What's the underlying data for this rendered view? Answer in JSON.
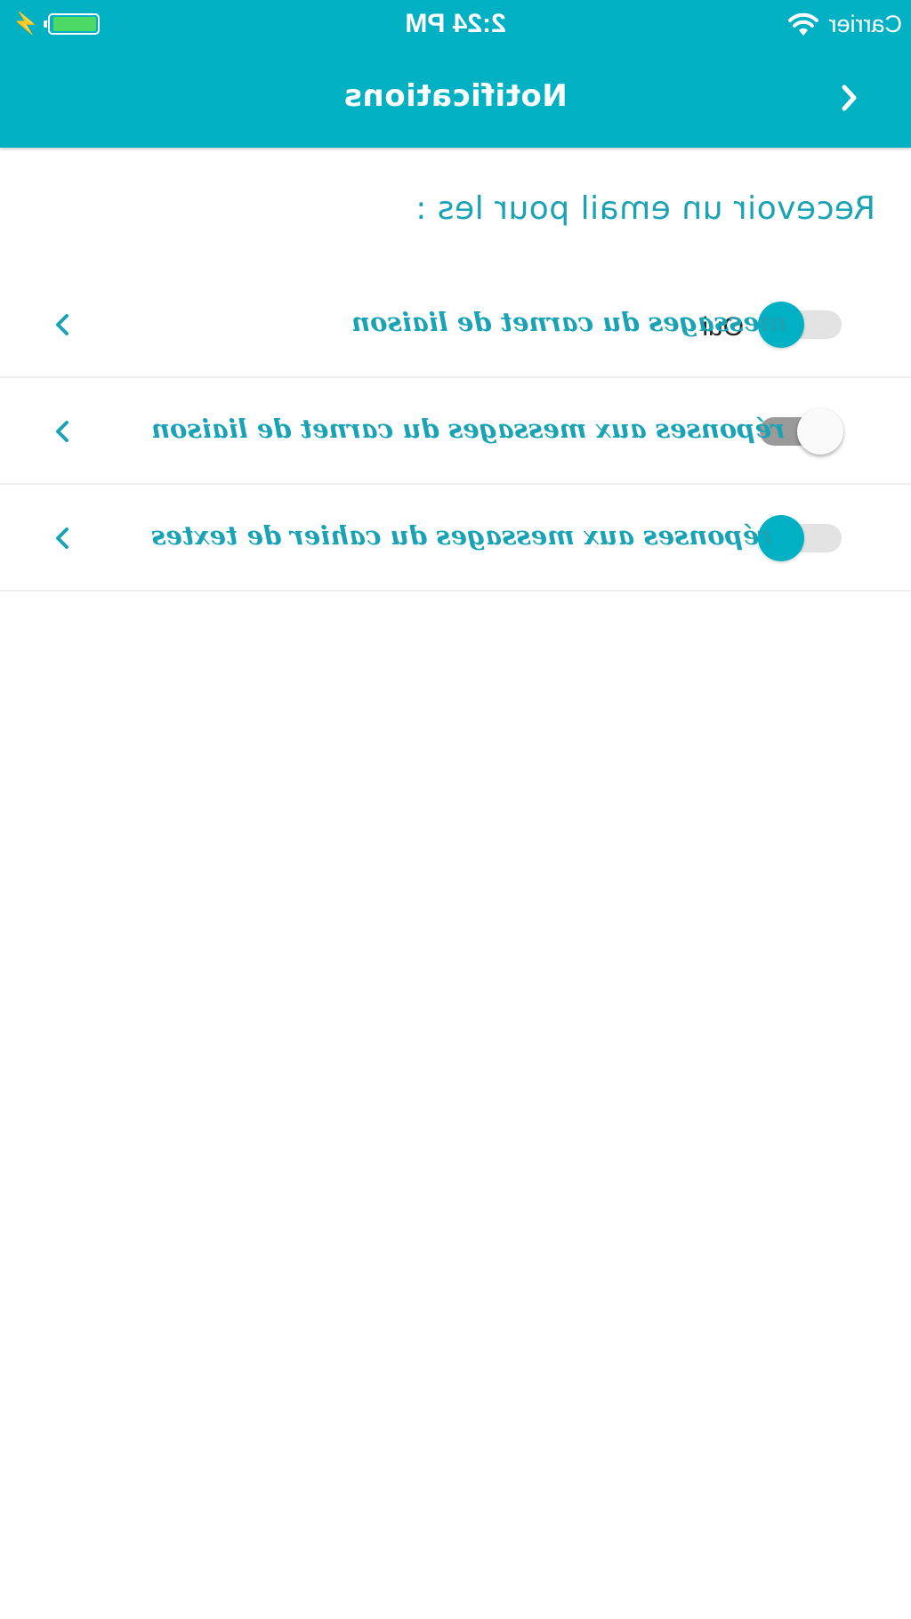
{
  "status_bar": {
    "carrier": "Carrier",
    "time": "2:24 PM",
    "battery_level": 0.95
  },
  "nav": {
    "title": "Notifications",
    "back_icon": "chevron-left-icon"
  },
  "section_title": "Recevoir un email pour les :",
  "rows": [
    {
      "label": "messages du carnet de liaison",
      "enabled": true,
      "state_label": "Oui"
    },
    {
      "label": "réponses aux messages du carnet de liaison",
      "enabled": false
    },
    {
      "label": "réponses aux messages du cahier de textes",
      "enabled": true
    }
  ],
  "colors": {
    "accent": "#00b1c4",
    "text_accent": "#1aa3b5",
    "battery": "#4cd964"
  }
}
